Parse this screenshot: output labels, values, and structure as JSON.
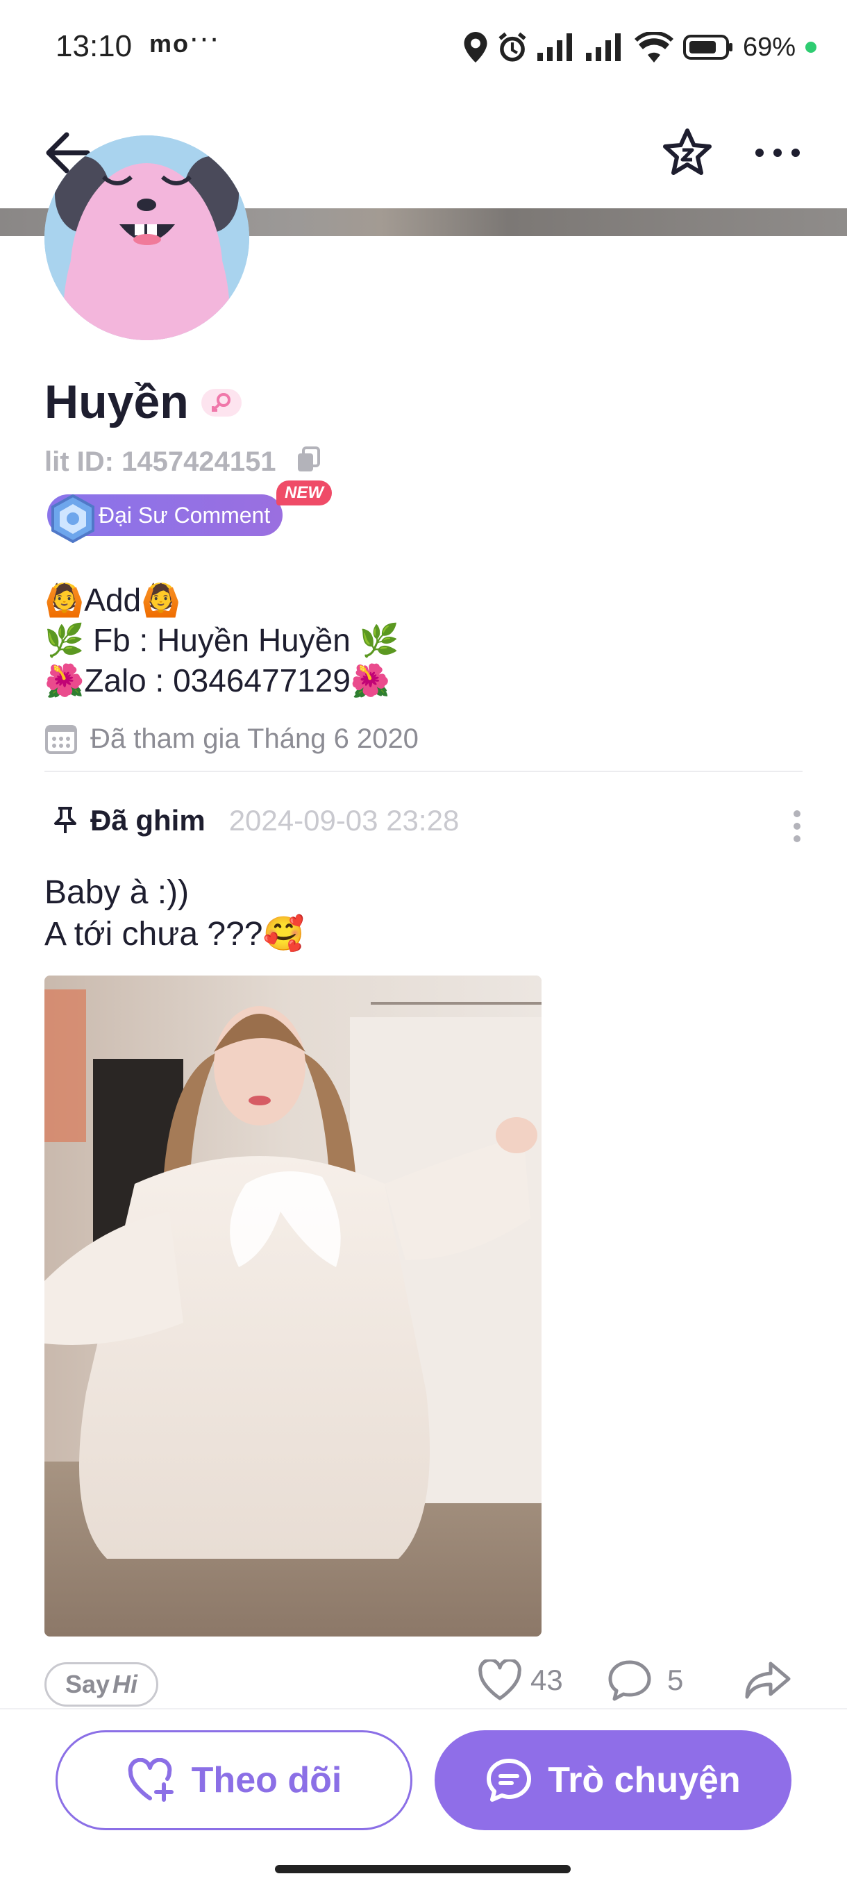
{
  "status_bar": {
    "time": "13:10",
    "left_icons": "mo",
    "dots": "···",
    "battery_percent": "69%"
  },
  "nav": {
    "back_icon": "arrow-left-icon",
    "star_icon": "star-icon",
    "more_icon": "more-horizontal-icon"
  },
  "profile": {
    "name": "Huyền",
    "lit_id": "lit ID: 1457424151",
    "badge_label": "Đại Sư Comment",
    "badge_new": "NEW",
    "bio_lines": [
      "🙆Add🙆",
      "🌿 Fb : Huyền Huyền 🌿",
      "🌺Zalo : 0346477129🌺"
    ],
    "joined": "Đã tham gia Tháng 6 2020"
  },
  "post": {
    "pinned_label": "Đã ghim",
    "date": "2024-09-03 23:28",
    "text_lines": [
      "Baby à :))",
      "A tới chưa ???🥰"
    ],
    "sayhi_label_1": "Say",
    "sayhi_label_2": "Hi",
    "likes": "43",
    "comments": "5"
  },
  "bottom": {
    "follow_label": "Theo dõi",
    "chat_label": "Trò chuyện"
  },
  "colors": {
    "accent": "#8f6ee8",
    "badge_new": "#ef4b67",
    "muted_text": "#8c8c94"
  }
}
